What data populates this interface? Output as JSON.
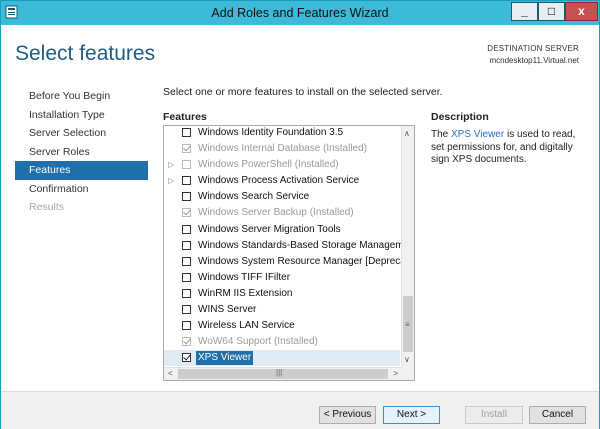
{
  "window": {
    "title": "Add Roles and Features Wizard"
  },
  "header": {
    "title": "Select features",
    "destination_label": "DESTINATION SERVER",
    "destination_value": "mcndesktop11.Virtual.net"
  },
  "nav": {
    "items": [
      {
        "label": "Before You Begin",
        "state": "normal"
      },
      {
        "label": "Installation Type",
        "state": "normal"
      },
      {
        "label": "Server Selection",
        "state": "normal"
      },
      {
        "label": "Server Roles",
        "state": "normal"
      },
      {
        "label": "Features",
        "state": "active"
      },
      {
        "label": "Confirmation",
        "state": "normal"
      },
      {
        "label": "Results",
        "state": "disabled"
      }
    ]
  },
  "main": {
    "instruction": "Select one or more features to install on the selected server.",
    "features_label": "Features",
    "description_label": "Description",
    "description": {
      "prefix": "The ",
      "link": "XPS Viewer",
      "suffix": " is used to read, set permissions for, and digitally sign XPS documents."
    }
  },
  "features": [
    {
      "label": "Windows Identity Foundation 3.5",
      "checked": false,
      "installed": false,
      "expandable": false
    },
    {
      "label": "Windows Internal Database (Installed)",
      "checked": true,
      "installed": true,
      "expandable": false
    },
    {
      "label": "Windows PowerShell (Installed)",
      "checked": false,
      "installed": true,
      "expandable": true
    },
    {
      "label": "Windows Process Activation Service",
      "checked": false,
      "installed": false,
      "expandable": true
    },
    {
      "label": "Windows Search Service",
      "checked": false,
      "installed": false,
      "expandable": false
    },
    {
      "label": "Windows Server Backup (Installed)",
      "checked": true,
      "installed": true,
      "expandable": false
    },
    {
      "label": "Windows Server Migration Tools",
      "checked": false,
      "installed": false,
      "expandable": false
    },
    {
      "label": "Windows Standards-Based Storage Management",
      "checked": false,
      "installed": false,
      "expandable": false
    },
    {
      "label": "Windows System Resource Manager [Deprecated]",
      "checked": false,
      "installed": false,
      "expandable": false
    },
    {
      "label": "Windows TIFF IFilter",
      "checked": false,
      "installed": false,
      "expandable": false
    },
    {
      "label": "WinRM IIS Extension",
      "checked": false,
      "installed": false,
      "expandable": false
    },
    {
      "label": "WINS Server",
      "checked": false,
      "installed": false,
      "expandable": false
    },
    {
      "label": "Wireless LAN Service",
      "checked": false,
      "installed": false,
      "expandable": false
    },
    {
      "label": "WoW64 Support (Installed)",
      "checked": true,
      "installed": true,
      "expandable": false
    },
    {
      "label": "XPS Viewer",
      "checked": true,
      "installed": false,
      "expandable": false,
      "selected": true
    }
  ],
  "buttons": {
    "previous": "< Previous",
    "next": "Next >",
    "install": "Install",
    "cancel": "Cancel"
  },
  "colors": {
    "title_bar": "#3dbad8",
    "accent": "#1e6fac",
    "header_title": "#1d5d86",
    "close_button": "#c75050"
  }
}
